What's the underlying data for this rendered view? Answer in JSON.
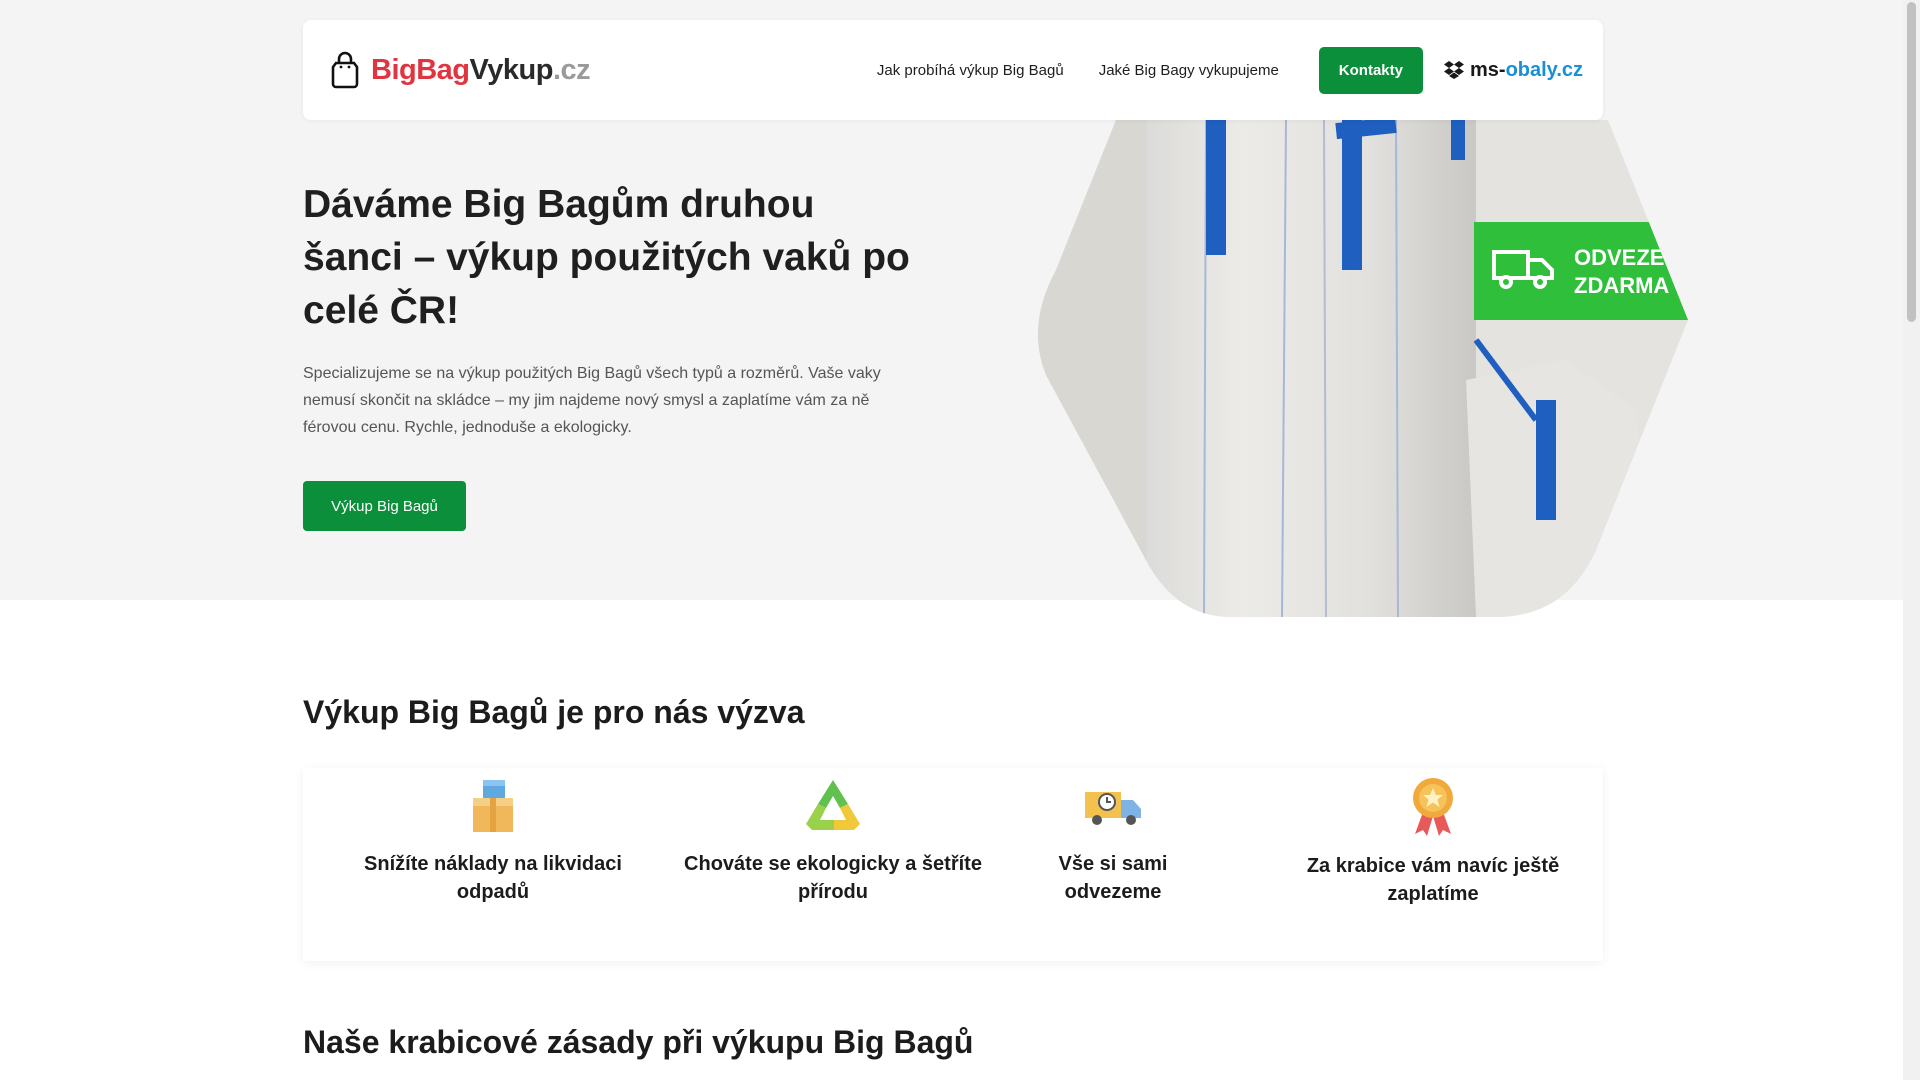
{
  "header": {
    "logo": {
      "big": "BigBag",
      "vykup": "Vykup",
      "cz": ".cz"
    },
    "nav": [
      {
        "label": "Jak probíhá výkup Big Bagů"
      },
      {
        "label": "Jaké Big Bagy vykupujeme"
      }
    ],
    "contact_label": "Kontakty",
    "partner": {
      "ms": "ms-",
      "obaly": "obaly.cz"
    }
  },
  "hero": {
    "title": "Dáváme Big Bagům druhou šanci – výkup použitých vaků po celé ČR!",
    "text": "Specializujeme se na výkup použitých Big Bagů všech typů a rozměrů. Vaše vaky nemusí skončit na skládce – my jim najdeme nový smysl a zaplatíme vám za ně férovou cenu. Rychle, jednoduše a ekologicky.",
    "button_label": "Výkup Big Bagů",
    "banner_line1": "ODVEZEME",
    "banner_line2": "ZDARMA"
  },
  "challenge": {
    "title": "Výkup Big Bagů je pro nás výzva",
    "features": [
      {
        "icon": "boxes-icon",
        "label": "Snížíte náklady na likvidaci odpadů"
      },
      {
        "icon": "recycle-icon",
        "label": "Chováte se ekologicky a šetříte přírodu"
      },
      {
        "icon": "delivery-truck-icon",
        "label": "Vše si sami odvezeme"
      },
      {
        "icon": "award-medal-icon",
        "label": "Za krabice vám navíc ještě zaplatíme"
      }
    ]
  },
  "principles": {
    "title": "Naše krabicové zásady při výkupu Big Bagů"
  },
  "colors": {
    "brand_red": "#e0343f",
    "brand_green": "#0b8f3a",
    "partner_blue": "#1a8fd6",
    "hero_bg": "#f4f4f4"
  }
}
